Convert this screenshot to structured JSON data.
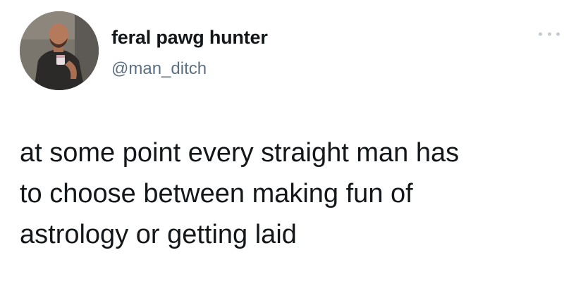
{
  "author": {
    "display_name": "feral pawg hunter",
    "handle": "@man_ditch",
    "avatar_icon": "profile-photo"
  },
  "tweet": {
    "lines": [
      "at some point every straight man has",
      "to choose between making fun of",
      "astrology or getting laid"
    ]
  },
  "menu": {
    "icon": "more-dots-icon"
  },
  "colors": {
    "name_text": "#14171a",
    "handle_text": "#5b7083",
    "menu_dots": "#c4cbd2",
    "background": "#ffffff"
  }
}
